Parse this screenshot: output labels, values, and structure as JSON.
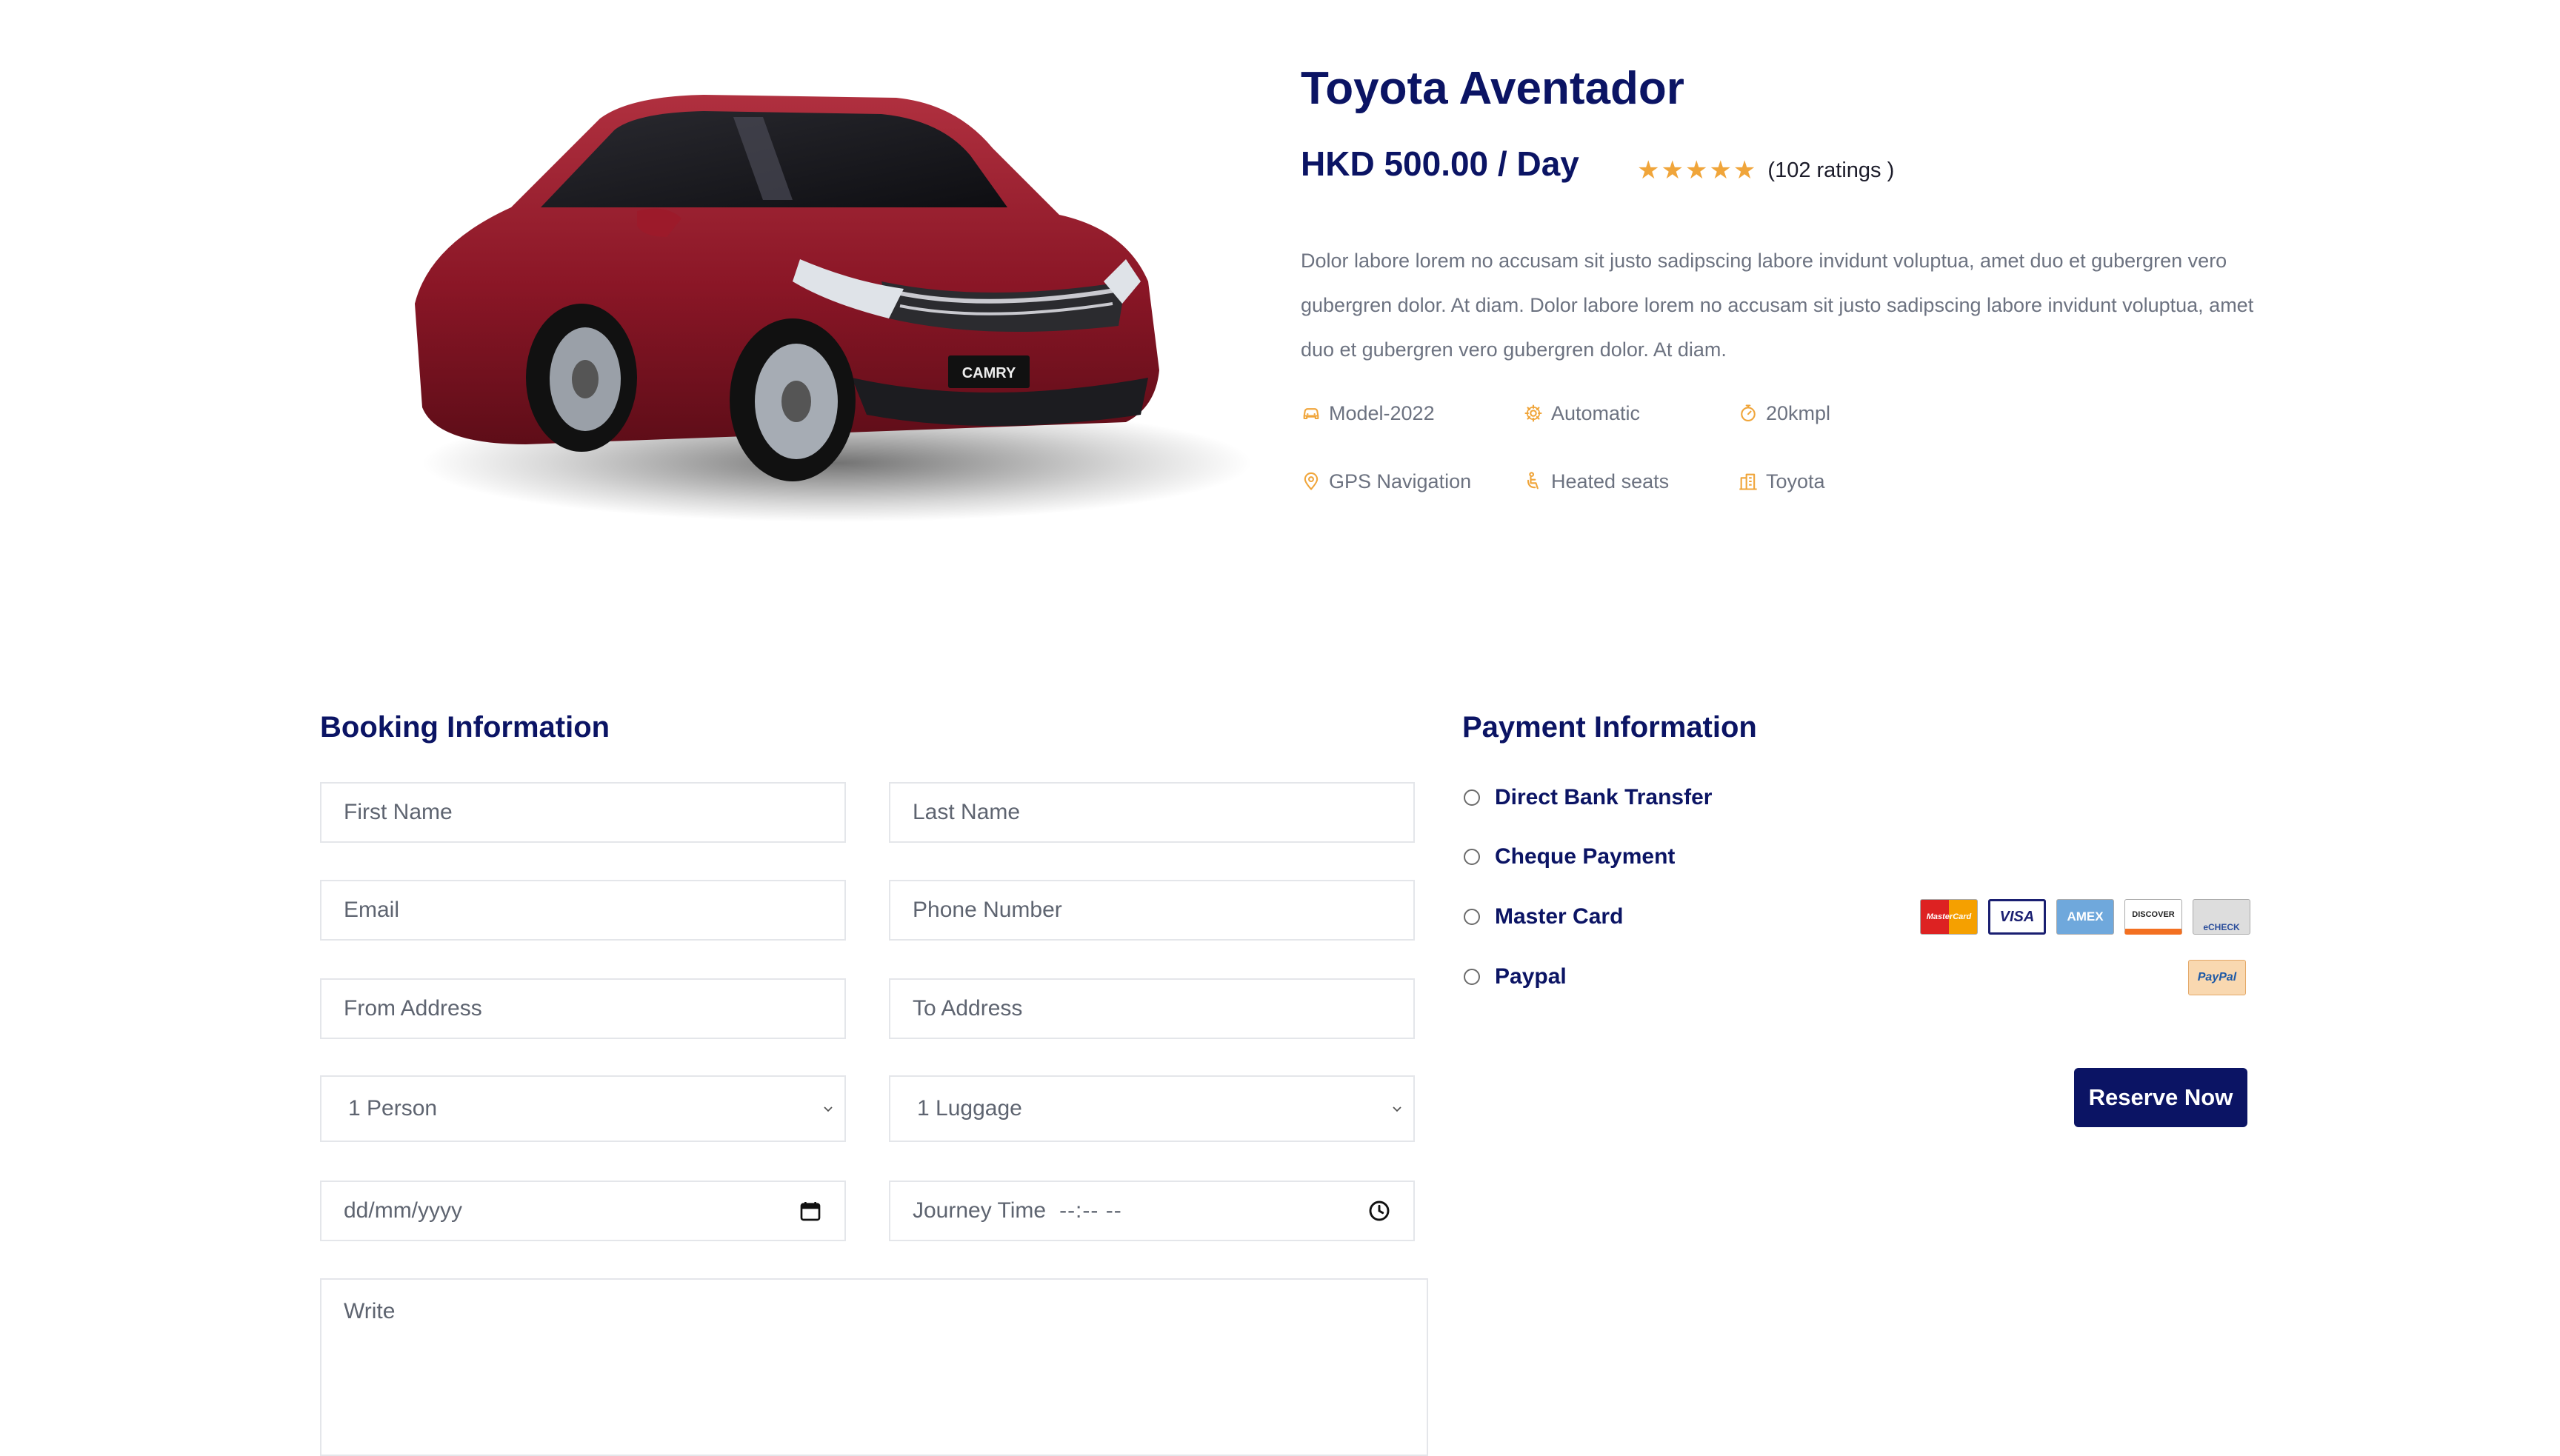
{
  "product": {
    "image_alt": "red Toyota Camry sedan",
    "plate_text": "CAMRY",
    "title": "Toyota Aventador",
    "price": "HKD 500.00 / Day",
    "stars": "★★★★★",
    "rating_value": 5,
    "ratings_text": "(102 ratings )",
    "description": "Dolor labore lorem no accusam sit justo sadipscing labore invidunt voluptua, amet duo et gubergren vero gubergren dolor. At diam. Dolor labore lorem no accusam sit justo sadipscing labore invidunt voluptua, amet duo et gubergren vero gubergren dolor. At diam.",
    "features": [
      {
        "label": "Model-2022",
        "icon": "car-icon"
      },
      {
        "label": "Automatic",
        "icon": "gear-icon"
      },
      {
        "label": "20kmpl",
        "icon": "fuel-gauge-icon"
      },
      {
        "label": "GPS Navigation",
        "icon": "map-pin-icon"
      },
      {
        "label": "Heated seats",
        "icon": "seat-icon"
      },
      {
        "label": "Toyota",
        "icon": "building-icon"
      }
    ]
  },
  "booking": {
    "title": "Booking Information",
    "first_name": "First Name",
    "last_name": "Last Name",
    "email": "Email",
    "phone": "Phone Number",
    "from_address": "From Address",
    "to_address": "To Address",
    "persons_selected": "1 Person",
    "luggage_selected": "1 Luggage",
    "date_placeholder": "dd/mm/yyyy",
    "time_label": "Journey Time",
    "time_placeholder": "--:-- --",
    "notes_placeholder": "Write"
  },
  "payment": {
    "title": "Payment Information",
    "options": [
      {
        "label": "Direct Bank Transfer"
      },
      {
        "label": "Cheque Payment"
      },
      {
        "label": "Master Card"
      },
      {
        "label": "Paypal"
      }
    ],
    "card_logos": [
      "MasterCard",
      "VISA",
      "AMEX",
      "DISCOVER",
      "eCHECK"
    ],
    "paypal_logo": "PayPal",
    "reserve_label": "Reserve Now"
  },
  "colors": {
    "navy": "#0b1464",
    "star": "#f0a53a",
    "icon_orange": "#f0a53a",
    "text_gray": "#6c7280",
    "car_red": "#8e1a2a"
  }
}
